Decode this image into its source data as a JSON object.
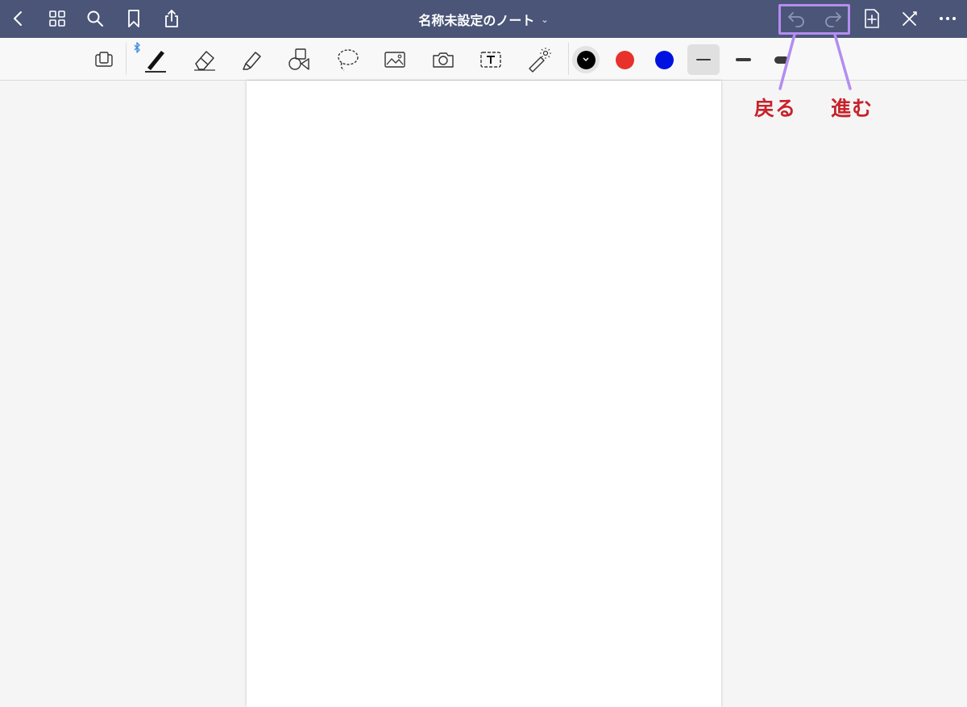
{
  "header": {
    "title": "名称未設定のノート",
    "title_dropdown_icon": "chevron-down-icon",
    "left_icons": [
      "back-chevron-icon",
      "grid-icon",
      "search-icon",
      "bookmark-icon",
      "share-icon"
    ],
    "right_icons": [
      "undo-icon",
      "redo-icon",
      "add-page-icon",
      "close-editing-icon",
      "more-icon"
    ]
  },
  "toolbar": {
    "tools": [
      "page-zoom-icon",
      "pen-icon",
      "eraser-icon",
      "highlighter-icon",
      "shapes-icon",
      "lasso-icon",
      "image-icon",
      "camera-icon",
      "text-box-icon",
      "laser-pointer-icon"
    ],
    "bluetooth_icon": "bluetooth-icon",
    "colors": [
      "#000000",
      "#e8312a",
      "#0012e0"
    ],
    "selected_color": "#000000",
    "stroke_widths": [
      "thin",
      "medium",
      "thick"
    ],
    "selected_stroke": "thin"
  },
  "annotations": {
    "undo_label": "戻る",
    "redo_label": "進む",
    "highlight_color": "#b48df0",
    "label_color": "#c8222b"
  },
  "colors": {
    "topbar": "#4a5577",
    "toolbar": "#f8f8f8",
    "canvas": "#f5f5f5",
    "page": "#ffffff"
  }
}
